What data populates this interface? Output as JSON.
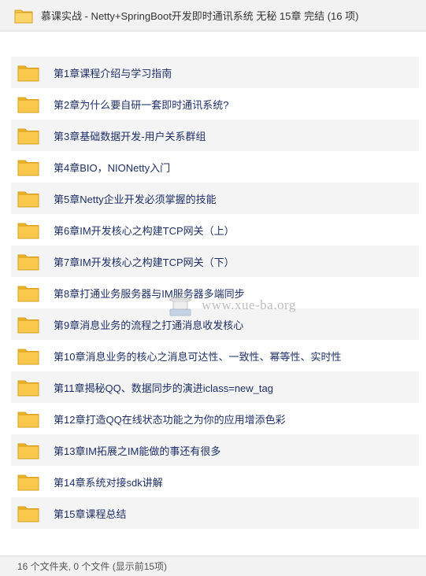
{
  "window": {
    "title": "慕课实战 - Netty+SpringBoot开发即时通讯系统 无秘 15章 完结 (16 项)",
    "title_icon": "folder-icon"
  },
  "folders": [
    {
      "name": "第1章课程介绍与学习指南"
    },
    {
      "name": "第2章为什么要自研一套即时通讯系统?"
    },
    {
      "name": "第3章基础数据开发-用户关系群组"
    },
    {
      "name": "第4章BIO，NIONetty入门"
    },
    {
      "name": "第5章Netty企业开发必须掌握的技能"
    },
    {
      "name": "第6章IM开发核心之构建TCP网关（上）"
    },
    {
      "name": "第7章IM开发核心之构建TCP网关（下）"
    },
    {
      "name": "第8章打通业务服务器与IM服务器多端同步"
    },
    {
      "name": "第9章消息业务的流程之打通消息收发核心"
    },
    {
      "name": "第10章消息业务的核心之消息可达性、一致性、幂等性、实时性"
    },
    {
      "name": "第11章揭秘QQ、数据同步的演进iclass=new_tag"
    },
    {
      "name": "第12章打造QQ在线状态功能之为你的应用增添色彩"
    },
    {
      "name": "第13章IM拓展之IM能做的事还有很多"
    },
    {
      "name": "第14章系统对接sdk讲解"
    },
    {
      "name": "第15章课程总结"
    }
  ],
  "watermark": {
    "text": "www.xue-ba.org"
  },
  "status": {
    "text": "16 个文件夹, 0 个文件 (显示前15项)"
  },
  "colors": {
    "folder_fill": "#f8c94a",
    "folder_tab": "#f0b429",
    "folder_stroke": "#d9a020",
    "label_text": "#1d2f66",
    "row_alt": "#f4f4f4"
  }
}
